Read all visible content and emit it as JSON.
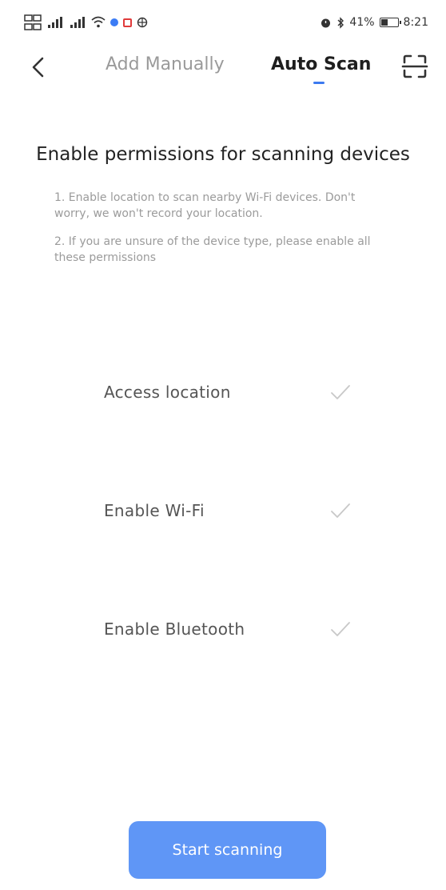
{
  "status_bar": {
    "battery_percent": "41%",
    "battery_level": 0.41,
    "time": "8:21"
  },
  "nav": {
    "tabs": [
      {
        "label": "Add Manually",
        "active": false
      },
      {
        "label": "Auto Scan",
        "active": true
      }
    ],
    "accent_color": "#3c7af0"
  },
  "main": {
    "title": "Enable permissions for scanning devices",
    "tips": [
      "1. Enable location to scan nearby Wi-Fi devices. Don't worry, we won't record your location.",
      "2. If you are unsure of the device type, please enable all these permissions"
    ],
    "permissions": [
      {
        "label": "Access location",
        "granted": true
      },
      {
        "label": "Enable Wi-Fi",
        "granted": true
      },
      {
        "label": "Enable Bluetooth",
        "granted": true
      }
    ]
  },
  "footer": {
    "start_button_label": "Start scanning",
    "button_color": "#5f96f6"
  }
}
